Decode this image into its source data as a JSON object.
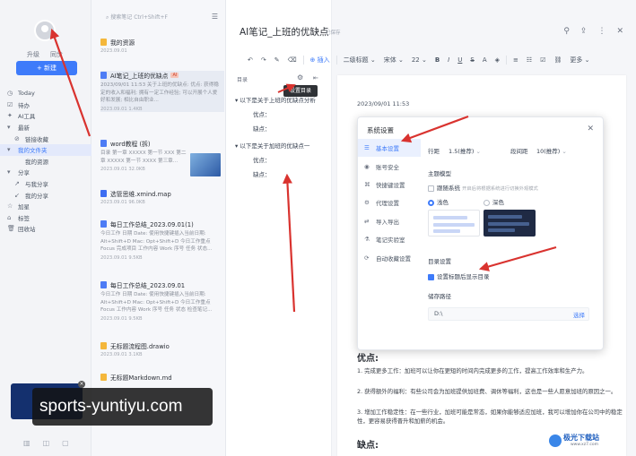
{
  "nav": {
    "upgrade": "升级",
    "sync": "同步",
    "new_button": "+ 新建",
    "items": [
      {
        "icon": "clock-icon",
        "glyph": "◷",
        "label": "Today"
      },
      {
        "icon": "todo-icon",
        "glyph": "☑",
        "label": "待办"
      },
      {
        "icon": "ai-icon",
        "glyph": "✦",
        "label": "AI工具"
      },
      {
        "icon": "folder-icon",
        "glyph": "▾",
        "label": "最新"
      },
      {
        "icon": "link-icon",
        "glyph": "⊘",
        "label": "链接收藏"
      },
      {
        "icon": "folder-icon",
        "glyph": "▾",
        "label": "我的文件夹"
      },
      {
        "icon": "sub-icon",
        "glyph": "",
        "label": "我的资源"
      },
      {
        "icon": "share-icon",
        "glyph": "▾",
        "label": "分享"
      },
      {
        "icon": "share-out-icon",
        "glyph": "↗",
        "label": "与我分享"
      },
      {
        "icon": "share-in-icon",
        "glyph": "↙",
        "label": "我的分享"
      },
      {
        "icon": "star-icon",
        "glyph": "☆",
        "label": "加星"
      },
      {
        "icon": "tag-icon",
        "glyph": "⌂",
        "label": "标签"
      },
      {
        "icon": "trash-icon",
        "glyph": "🗑",
        "label": "回收站"
      }
    ]
  },
  "watermark": "sports-yuntiyu.com",
  "list": {
    "search_placeholder": "搜索笔记 Ctrl+Shift+F",
    "notes": [
      {
        "type": "folder",
        "title": "我的资源",
        "body": "",
        "meta": "2023.09.01"
      },
      {
        "type": "doc",
        "title": "AI笔记_上班的优缺点",
        "tag": "AI",
        "body": "2023/09/01 11:53 关于上班的优缺点: 优点: 获得稳定的收入和福利; 拥有一定工作经验; 可以开展个人爱好和发展; 相比自由职业...",
        "meta": "2023.09.01 1.4KB"
      },
      {
        "type": "doc",
        "title": "word教程 (拆)",
        "body": "目录 第一章 XXXXX 第一节 XXX 第二章 XXXXX 第一节 XXXX 第三章...",
        "meta": "2023.09.01 32.0KB"
      },
      {
        "type": "mind",
        "title": "选管思维.xmind.map",
        "body": "",
        "meta": "2023.09.01 96.0KB"
      },
      {
        "type": "doc",
        "title": "每日工作总结_2023.09.01(1)",
        "body": "今日工作 日期 Date: 使用快捷键插入当前日期: Alt+Shift+D Mac: Opt+Shift+D 今日工作重点 Focus 完成项目 工作内容 Work 序号 任务 状态...",
        "meta": "2023.09.01 9.5KB"
      },
      {
        "type": "doc",
        "title": "每日工作总结_2023.09.01",
        "body": "今日工作 日期 Date: 使用快捷键插入当前日期: Alt+Shift+D Mac: Opt+Shift+D 今日工作重点 Focus 工作内容 Work 序号 任务 状态 检查笔记...",
        "meta": "2023.09.01 9.5KB"
      },
      {
        "type": "folder",
        "title": "无标题流程图.drawio",
        "body": "",
        "meta": "2023.09.01 3.1KB"
      },
      {
        "type": "folder",
        "title": "无标题Markdown.md",
        "body": "",
        "meta": ""
      }
    ]
  },
  "doc": {
    "title": "AI笔记_上班的优缺点",
    "saved": "已保存",
    "outline_label": "目录",
    "outline_tooltip": "设置目录",
    "outline": [
      {
        "title": "以下是关于上班的优缺点分析",
        "subs": [
          "优点：",
          "缺点："
        ]
      },
      {
        "title": "以下是关于加班的优缺点一",
        "subs": [
          "优点：",
          "缺点："
        ]
      }
    ],
    "date": "2023/09/01 11:53",
    "pros_heading": "优点:",
    "pros": [
      "1. 完成更多工作：加班可以让你在更短的时间内完成更多的工作，提高工作效率和生产力。",
      "2. 获得额外的福利：有些公司会为加班提供加班费、调休等福利，这也是一些人愿意加班的原因之一。",
      "3. 增加工作稳定性：在一些行业，加班可能是常态，如果你能够适应加班，我可以增加你在公司中的稳定性，更容易获得晋升和加薪的机会。"
    ],
    "cons_heading": "缺点:"
  },
  "toolbar": {
    "insert": "插入",
    "heading": "二级标题",
    "font": "宋体",
    "size": "22",
    "more": "更多"
  },
  "dialog": {
    "title": "系统设置",
    "tabs": [
      {
        "icon": "doc-settings-icon",
        "glyph": "☰",
        "label": "基本设置",
        "active": true
      },
      {
        "icon": "account-icon",
        "glyph": "◉",
        "label": "账号安全",
        "active": false
      },
      {
        "icon": "shortcut-icon",
        "glyph": "⌘",
        "label": "快捷键设置",
        "active": false
      },
      {
        "icon": "proxy-icon",
        "glyph": "⚙",
        "label": "代理设置",
        "active": false
      },
      {
        "icon": "import-icon",
        "glyph": "⇄",
        "label": "导入导出",
        "active": false
      },
      {
        "icon": "lab-icon",
        "glyph": "⚗",
        "label": "笔记实验室",
        "active": false
      },
      {
        "icon": "autosave-icon",
        "glyph": "⟳",
        "label": "自动收藏设置",
        "active": false
      }
    ],
    "line_spacing_label": "行距",
    "line_spacing_value": "1.5(推荐)",
    "para_spacing_label": "段间距",
    "para_spacing_value": "10(推荐)",
    "theme_label": "主题模型",
    "follow_system": "跟随系统",
    "follow_hint": "开启后将根据系统进行切换外观模式",
    "theme_light": "浅色",
    "theme_dark": "深色",
    "toc_label": "目录设置",
    "toc_checkbox": "设置标题后显示目录",
    "storage_label": "储存路径",
    "storage_path": "D:\\",
    "browse": "选择"
  },
  "top_icons": [
    "pin-icon",
    "share-icon",
    "more-icon",
    "close-icon"
  ],
  "logo": {
    "name": "极光下载站",
    "url_text": "www.xz7.com"
  }
}
